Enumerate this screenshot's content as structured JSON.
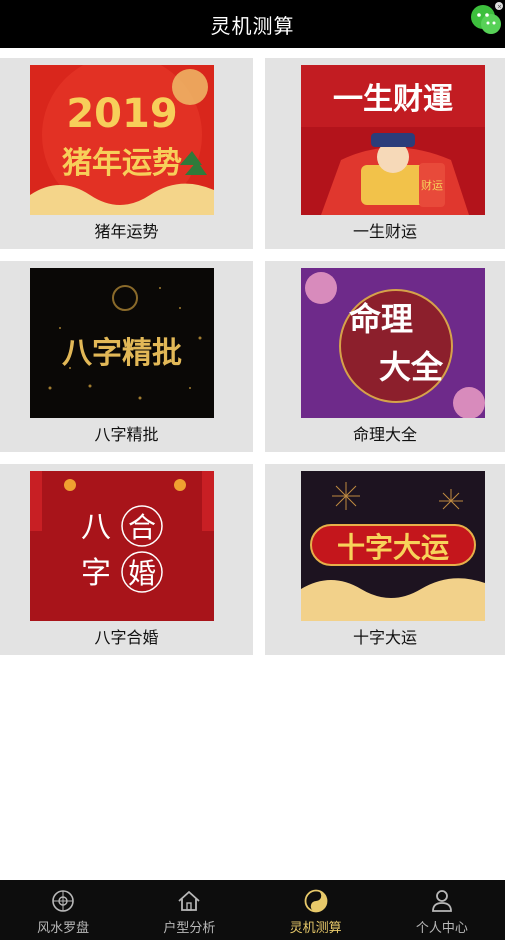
{
  "header": {
    "title": "灵机测算"
  },
  "cards": [
    {
      "label": "猪年运势",
      "art": {
        "line1": "2019",
        "line2": "猪年运势"
      }
    },
    {
      "label": "一生财运",
      "art": {
        "line1": "一生财運",
        "tag": "财运"
      }
    },
    {
      "label": "八字精批",
      "art": {
        "line1": "八字精批"
      }
    },
    {
      "label": "命理大全",
      "art": {
        "line1": "命理",
        "line2": "大全"
      }
    },
    {
      "label": "八字合婚",
      "art": {
        "c1": "八",
        "c2": "合",
        "c3": "字",
        "c4": "婚"
      }
    },
    {
      "label": "十字大运",
      "art": {
        "line1": "十字大运"
      }
    }
  ],
  "tabs": [
    {
      "label": "风水罗盘",
      "icon": "compass-icon",
      "active": false
    },
    {
      "label": "户型分析",
      "icon": "house-icon",
      "active": false
    },
    {
      "label": "灵机测算",
      "icon": "taiji-icon",
      "active": true
    },
    {
      "label": "个人中心",
      "icon": "person-icon",
      "active": false
    }
  ],
  "colors": {
    "header_bg": "#000000",
    "card_bg": "#e3e3e3",
    "tab_active": "#e7c96a",
    "tab_inactive": "#b8b8b8"
  }
}
